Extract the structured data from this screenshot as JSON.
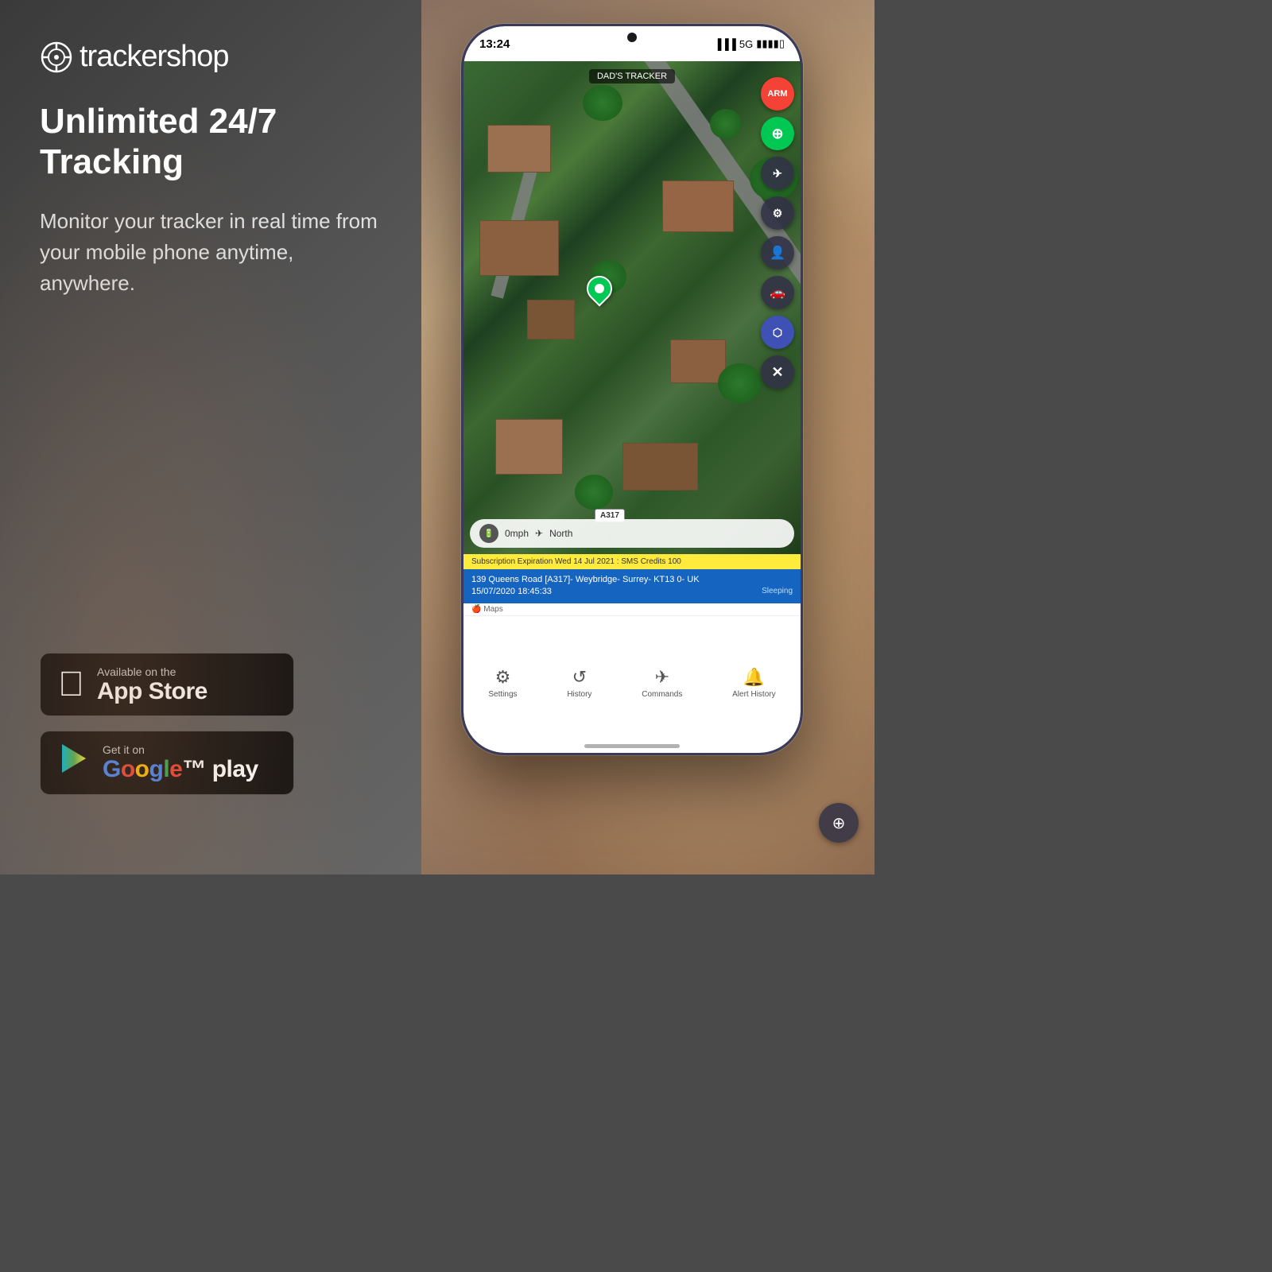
{
  "brand": {
    "name": "trackershop",
    "tagline": "Unlimited 24/7\nTracking",
    "description": "Monitor your tracker in real time from your mobile phone anytime, anywhere.",
    "logo_symbol": "⊕"
  },
  "store_buttons": {
    "apple": {
      "line1": "Available on the",
      "line2": "App Store",
      "icon": ""
    },
    "google": {
      "line1": "Get it on",
      "line2": "Google play"
    }
  },
  "phone": {
    "status_time": "13:24",
    "status_signal": "5G",
    "tracker_name": "DAD'S TRACKER",
    "arm_label": "ARM",
    "speed": "0mph",
    "direction": "North",
    "subscription_text": "Subscription Expiration Wed 14 Jul 2021 : SMS Credits 100",
    "address_line1": "139 Queens Road [A317]- Weybridge- Surrey- KT13 0- UK",
    "address_line2": "15/07/2020 18:45:33",
    "address_status": "Sleeping",
    "maps_credit": "Maps",
    "road_label": "A317",
    "nav_items": [
      {
        "label": "Settings",
        "icon": "⚙"
      },
      {
        "label": "History",
        "icon": "↺"
      },
      {
        "label": "Commands",
        "icon": "✈"
      },
      {
        "label": "Alert History",
        "icon": "🔔"
      }
    ]
  },
  "colors": {
    "accent_green": "#00c853",
    "accent_red": "#f44336",
    "accent_blue": "#1565c0",
    "arm_red": "#f44336",
    "nav_blue": "#3f51b5"
  }
}
